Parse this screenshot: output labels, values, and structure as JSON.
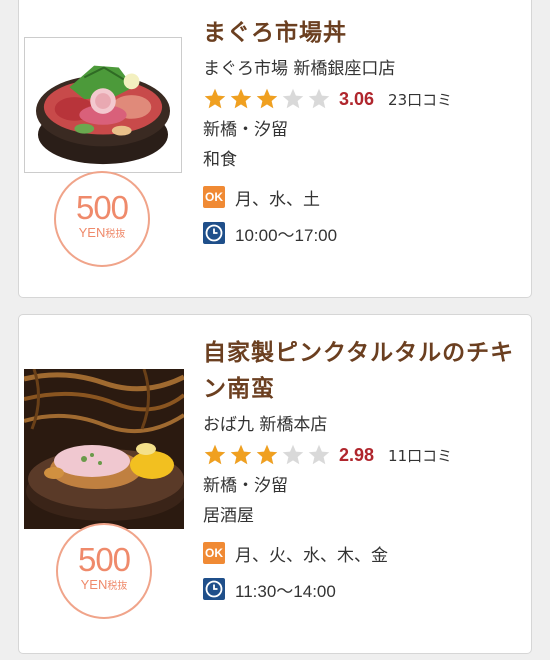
{
  "cards": [
    {
      "title": "まぐろ市場丼",
      "shop": "まぐろ市場 新橋銀座口店",
      "rating": 3.06,
      "score_text": "3.06",
      "reviews": "23口コミ",
      "area": "新橋・汐留",
      "genre": "和食",
      "ok_label": "OK",
      "days": "月、水、土",
      "hours": "10:00〜17:00",
      "price": "500",
      "price_unit": "YEN",
      "price_tax": "税抜",
      "icon_thumb": "tuna-bowl-photo"
    },
    {
      "title": "自家製ピンクタルタルのチキン南蛮",
      "shop": "おば九 新橋本店",
      "rating": 2.98,
      "score_text": "2.98",
      "reviews": "11口コミ",
      "area": "新橋・汐留",
      "genre": "居酒屋",
      "ok_label": "OK",
      "days": "月、火、水、木、金",
      "hours": "11:30〜14:00",
      "price": "500",
      "price_unit": "YEN",
      "price_tax": "税抜",
      "icon_thumb": "chicken-nanban-photo"
    }
  ],
  "colors": {
    "title": "#6b3f20",
    "score": "#b0262d",
    "star_filled": "#f0a020",
    "star_empty": "#d9d9d9",
    "ok_badge": "#f08a34",
    "clock": "#1f4f8a",
    "price": "#ef8a6b"
  }
}
